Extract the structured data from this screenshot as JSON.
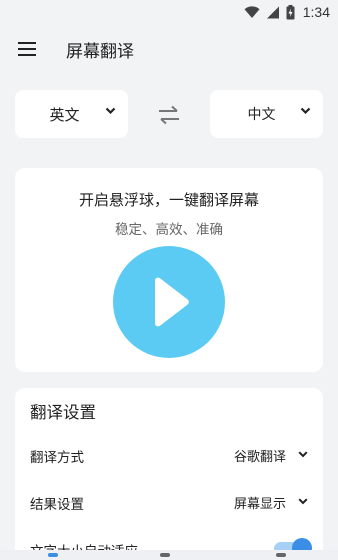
{
  "status_bar": {
    "time": "1:34"
  },
  "app_bar": {
    "title": "屏幕翻译"
  },
  "languages": {
    "source": "英文",
    "target": "中文"
  },
  "float_card": {
    "title": "开启悬浮球，一键翻译屏幕",
    "subtitle": "稳定、高效、准确"
  },
  "settings": {
    "title": "翻译设置",
    "rows": [
      {
        "name": "翻译方式",
        "value": "谷歌翻译"
      },
      {
        "name": "结果设置",
        "value": "屏幕显示"
      },
      {
        "name": "文字大小自动适应",
        "toggle_on": true
      }
    ]
  },
  "colors": {
    "play": "#5ccbf3",
    "toggle": "#3a8ee6",
    "background": "#f2f3f5"
  }
}
